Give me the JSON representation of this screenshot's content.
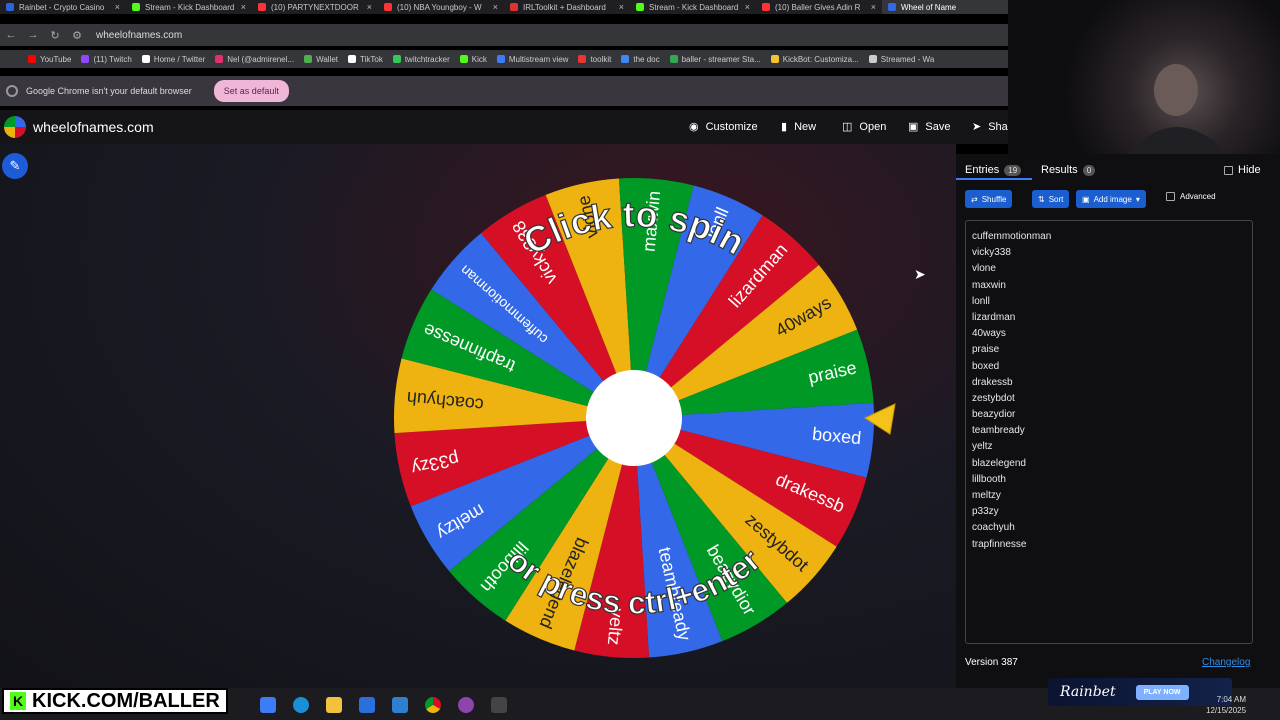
{
  "browser": {
    "tabs": [
      {
        "title": "Rainbet - Crypto Casino",
        "color": "#2b66d9"
      },
      {
        "title": "Stream - Kick Dashboard",
        "color": "#53fc18"
      },
      {
        "title": "(10) PARTYNEXTDOOR",
        "color": "#ff3333"
      },
      {
        "title": "(10) NBA Youngboy - W",
        "color": "#ff3333"
      },
      {
        "title": "IRLToolkit + Dashboard",
        "color": "#d33"
      },
      {
        "title": "Stream - Kick Dashboard",
        "color": "#53fc18"
      },
      {
        "title": "(10) Baller Gives Adin R",
        "color": "#ff3333"
      },
      {
        "title": "Wheel of Name",
        "color": "#3369e8",
        "active": true
      }
    ],
    "url": "wheelofnames.com",
    "bookmarks": [
      {
        "label": "YouTube",
        "color": "#ff0000"
      },
      {
        "label": "(11) Twitch",
        "color": "#9146ff"
      },
      {
        "label": "Home / Twitter",
        "color": "#ffffff"
      },
      {
        "label": "Nel (@admirenel...",
        "color": "#e1306c"
      },
      {
        "label": "Wallet",
        "color": "#4caf50"
      },
      {
        "label": "TikTok",
        "color": "#ffffff"
      },
      {
        "label": "twitchtracker",
        "color": "#34c759"
      },
      {
        "label": "Kick",
        "color": "#53fc18"
      },
      {
        "label": "Multistream view",
        "color": "#3c7cf5"
      },
      {
        "label": "toolkit",
        "color": "#e33"
      },
      {
        "label": "the doc",
        "color": "#4285f4"
      },
      {
        "label": "baller - streamer Sta...",
        "color": "#34a853"
      },
      {
        "label": "KickBot: Customiza...",
        "color": "#f4c430"
      },
      {
        "label": "Streamed - Wa",
        "color": "#cccccc"
      }
    ],
    "infobar_text": "Google Chrome isn't your default browser",
    "set_default_label": "Set as default"
  },
  "header": {
    "site_name": "wheelofnames.com",
    "customize": "Customize",
    "new": "New",
    "open": "Open",
    "save": "Save",
    "share": "Sha"
  },
  "panel": {
    "entries_tab": "Entries",
    "entries_count": "19",
    "results_tab": "Results",
    "results_count": "0",
    "hide": "Hide",
    "shuffle": "Shuffle",
    "sort": "Sort",
    "add_image": "Add image",
    "advanced": "Advanced",
    "entries": [
      "cuffemmotionman",
      "vicky338",
      "vlone",
      "maxwin",
      "lonll",
      "lizardman",
      "40ways",
      "praise",
      "boxed",
      "drakessb",
      "zestybdot",
      "beazydior",
      "teambready",
      "yeltz",
      "blazelegend",
      "lillbooth",
      "meltzy",
      "p33zy",
      "coachyuh",
      "trapfinnesse"
    ],
    "version": "Version 387",
    "changelog": "Changelog"
  },
  "wheel": {
    "segments": [
      "cuffemmotionman",
      "vicky338",
      "vlone",
      "maxwin",
      "lonll",
      "lizardman",
      "40ways",
      "praise",
      "boxed",
      "drakessb",
      "zestybdot",
      "beazydior",
      "teambready",
      "yeltz",
      "blazelegend",
      "lillbooth",
      "meltzy",
      "p33zy",
      "coachyuh",
      "trapfinnesse"
    ],
    "colors": [
      "#3369e8",
      "#d50f25",
      "#eeb211",
      "#009925"
    ],
    "top_text": "Click to spin",
    "bottom_text": "or press ctrl+enter"
  },
  "overlay": {
    "kick_text": "KICK.COM/BALLER",
    "kick_letter": "K",
    "rainbet": "Rainbet",
    "play_now": "PLAY NOW"
  },
  "clock": {
    "time": "7:04 AM",
    "date": "12/15/2025"
  }
}
